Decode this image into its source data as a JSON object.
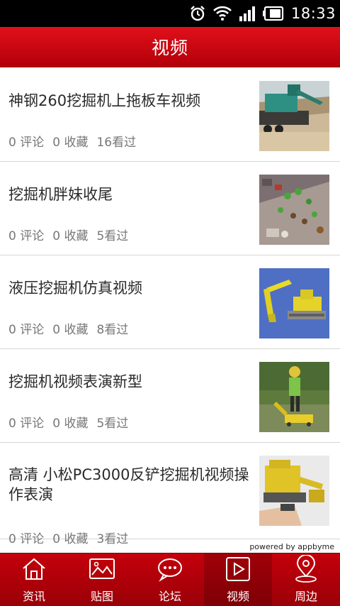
{
  "status_bar": {
    "time": "18:33"
  },
  "header": {
    "title": "视频"
  },
  "videos": [
    {
      "title": "神钢260挖掘机上拖板车视频",
      "comments": "0 评论",
      "favorites": "0 收藏",
      "views": "16看过"
    },
    {
      "title": "挖掘机胖妹收尾",
      "comments": "0 评论",
      "favorites": "0 收藏",
      "views": "5看过"
    },
    {
      "title": "液压挖掘机仿真视频",
      "comments": "0 评论",
      "favorites": "0 收藏",
      "views": "8看过"
    },
    {
      "title": "挖掘机视频表演新型",
      "comments": "0 评论",
      "favorites": "0 收藏",
      "views": "5看过"
    },
    {
      "title": "高清 小松PC3000反铲挖掘机视频操作表演",
      "comments": "0 评论",
      "favorites": "0 收藏",
      "views": "3看过"
    }
  ],
  "footer": {
    "powered_by": "powered by appbyme"
  },
  "tabs": [
    {
      "label": "资讯",
      "icon": "home-icon"
    },
    {
      "label": "贴图",
      "icon": "image-icon"
    },
    {
      "label": "论坛",
      "icon": "chat-icon"
    },
    {
      "label": "视频",
      "icon": "play-icon",
      "active": true
    },
    {
      "label": "周边",
      "icon": "location-icon"
    }
  ],
  "colors": {
    "brand_red": "#cc0010",
    "text": "#2a2a2a",
    "meta": "#777777"
  }
}
